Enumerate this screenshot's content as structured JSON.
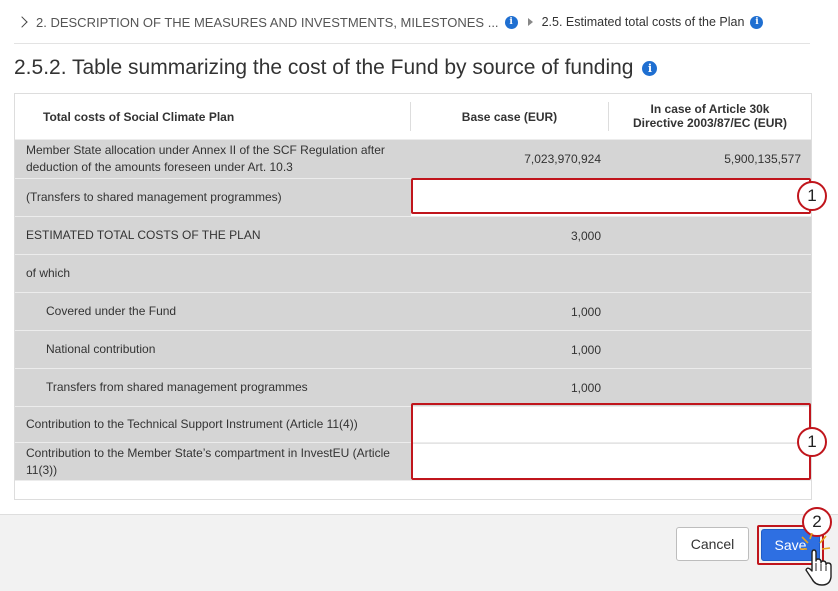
{
  "breadcrumb": {
    "item1": "2. DESCRIPTION OF THE MEASURES AND INVESTMENTS, MILESTONES ...",
    "item2": "2.5. Estimated total costs of the Plan"
  },
  "section_title": "2.5.2. Table summarizing the cost of the Fund by source of funding",
  "table": {
    "headers": {
      "col1": "Total costs of Social Climate Plan",
      "col2": "Base case (EUR)",
      "col3": "In case of Article 30k Directive 2003/87/EC (EUR)"
    },
    "rows": [
      {
        "label": "Member State allocation under Annex II of the SCF Regulation after deduction of the amounts foreseen under Art. 10.3",
        "base": "7,023,970,924",
        "art30k": "5,900,135,577"
      },
      {
        "label": "(Transfers to shared management programmes)",
        "base": "",
        "art30k": ""
      },
      {
        "label": "ESTIMATED TOTAL COSTS OF THE PLAN",
        "base": "3,000",
        "art30k": ""
      },
      {
        "label": "of which",
        "base": "",
        "art30k": ""
      },
      {
        "label": "Covered under the Fund",
        "base": "1,000",
        "art30k": ""
      },
      {
        "label": "National contribution",
        "base": "1,000",
        "art30k": ""
      },
      {
        "label": "Transfers from shared management programmes",
        "base": "1,000",
        "art30k": ""
      },
      {
        "label": "Contribution to the Technical Support Instrument (Article 11(4))",
        "base": "",
        "art30k": ""
      },
      {
        "label": "Contribution to the Member State’s compartment in InvestEU (Article 11(3))",
        "base": "",
        "art30k": ""
      }
    ]
  },
  "annotations": {
    "step1": "1",
    "step2": "2"
  },
  "buttons": {
    "cancel": "Cancel",
    "save": "Save"
  },
  "colors": {
    "accent": "#2e6fe2",
    "highlight": "#c0151c",
    "row_bg": "#d5d5d5",
    "info_icon": "#1f6fd1"
  },
  "icons": [
    "chevron-right-icon",
    "info-icon",
    "triangle-right-icon",
    "hand-cursor-icon"
  ]
}
